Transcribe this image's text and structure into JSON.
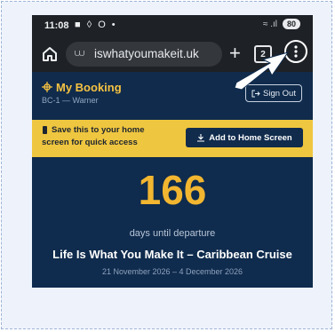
{
  "status_bar": {
    "time": "11:08",
    "icons": "■ ◊ O •",
    "signal": "≈ .ıl",
    "battery": "80"
  },
  "browser": {
    "url": "iswhatyoumakeit.uk",
    "new_tab_label": "+",
    "tab_count": "2"
  },
  "header": {
    "title": "My Booking",
    "subtitle": "BC-1 — Warner",
    "sign_out_label": "Sign Out"
  },
  "install_banner": {
    "line1": "Save this to your home",
    "line2": "screen for quick access",
    "button_label": "Add to Home Screen"
  },
  "countdown": {
    "days": "166",
    "label": "days until departure"
  },
  "cruise": {
    "title": "Life Is What You Make It – Caribbean Cruise",
    "dates": "21 November 2026 – 4 December 2026"
  },
  "colors": {
    "navy": "#0f2b4d",
    "gold": "#f2b630",
    "banner_yellow": "#efc63f",
    "browser_dark": "#1e2126"
  }
}
